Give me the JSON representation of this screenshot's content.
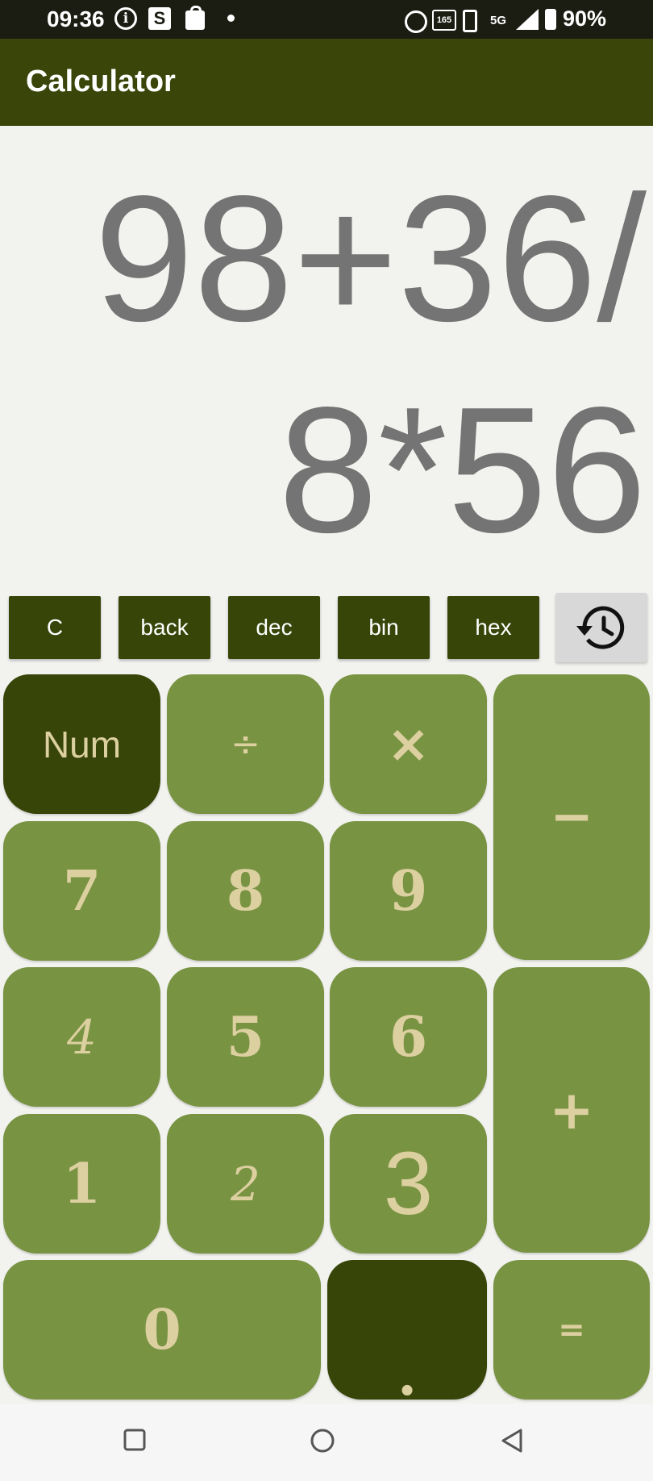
{
  "status_bar": {
    "time": "09:36",
    "battery": "90%",
    "network": "5G",
    "refresh_rate": "165"
  },
  "app_bar": {
    "title": "Calculator"
  },
  "display": {
    "expression": "98+36/8*56"
  },
  "function_row": {
    "clear": "C",
    "back": "back",
    "dec": "dec",
    "bin": "bin",
    "hex": "hex",
    "history_icon": "history-icon"
  },
  "keypad": {
    "num": "Num",
    "divide": "÷",
    "multiply": "×",
    "minus": "−",
    "plus": "+",
    "equals": "=",
    "dot": ".",
    "d0": "0",
    "d1": "1",
    "d2": "2",
    "d3": "3",
    "d4": "4",
    "d5": "5",
    "d6": "6",
    "d7": "7",
    "d8": "8",
    "d9": "9"
  },
  "colors": {
    "app_bar": "#3a4509",
    "key": "#789342",
    "key_dark": "#374509",
    "key_text": "#dccfa0",
    "display_text": "#747474"
  }
}
